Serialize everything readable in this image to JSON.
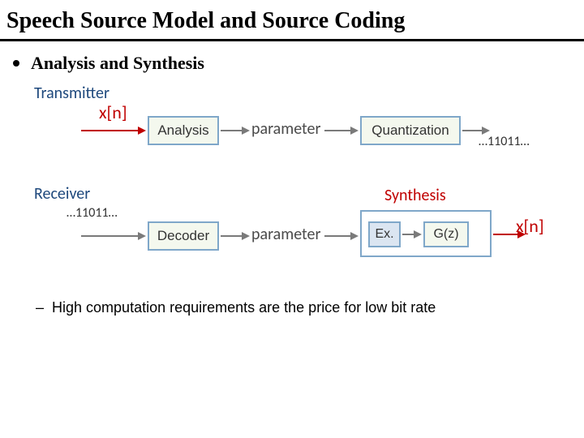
{
  "title": "Speech Source Model and Source Coding",
  "bullet": "Analysis and Synthesis",
  "transmitter": {
    "label": "Transmitter",
    "input_signal": "x[n]",
    "analysis_box": "Analysis",
    "parameter": "parameter",
    "quantization_box": "Quantization",
    "output_bits": "…11011…"
  },
  "receiver": {
    "label": "Receiver",
    "input_bits": "…11011…",
    "decoder_box": "Decoder",
    "parameter": "parameter",
    "synthesis_label": "Synthesis",
    "excitation_box": "Ex.",
    "filter_box": "G(z)",
    "output_signal": "x[n]"
  },
  "subpoint": "High computation requirements are the price for low bit rate"
}
